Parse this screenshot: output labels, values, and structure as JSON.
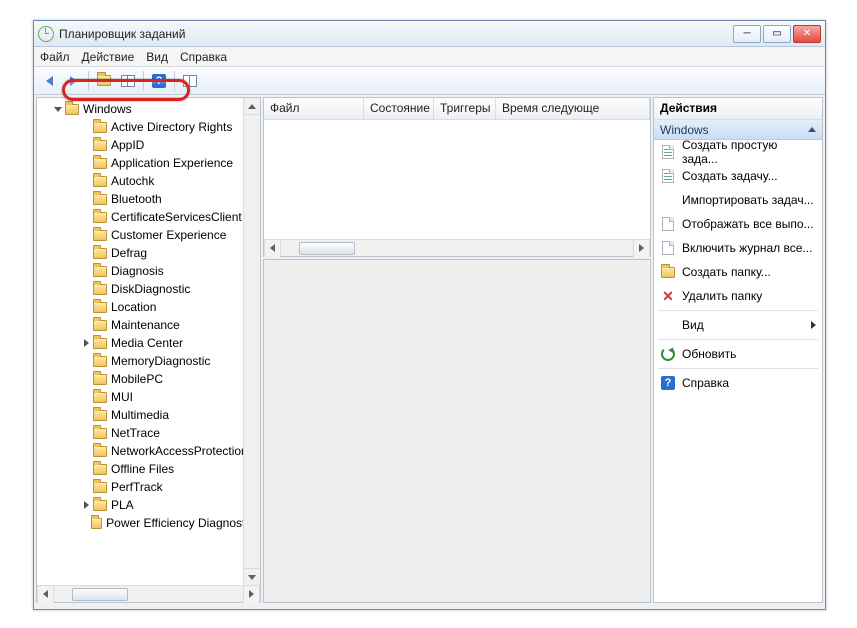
{
  "window": {
    "title": "Планировщик заданий"
  },
  "menu": {
    "file": "Файл",
    "action": "Действие",
    "view": "Вид",
    "help": "Справка"
  },
  "tree": {
    "root": "Windows",
    "children": [
      {
        "label": "Active Directory Rights",
        "expandable": false
      },
      {
        "label": "AppID",
        "expandable": false
      },
      {
        "label": "Application Experience",
        "expandable": false
      },
      {
        "label": "Autochk",
        "expandable": false
      },
      {
        "label": "Bluetooth",
        "expandable": false
      },
      {
        "label": "CertificateServicesClient",
        "expandable": false
      },
      {
        "label": "Customer Experience",
        "expandable": false
      },
      {
        "label": "Defrag",
        "expandable": false
      },
      {
        "label": "Diagnosis",
        "expandable": false
      },
      {
        "label": "DiskDiagnostic",
        "expandable": false
      },
      {
        "label": "Location",
        "expandable": false
      },
      {
        "label": "Maintenance",
        "expandable": false
      },
      {
        "label": "Media Center",
        "expandable": true
      },
      {
        "label": "MemoryDiagnostic",
        "expandable": false
      },
      {
        "label": "MobilePC",
        "expandable": false
      },
      {
        "label": "MUI",
        "expandable": false
      },
      {
        "label": "Multimedia",
        "expandable": false
      },
      {
        "label": "NetTrace",
        "expandable": false
      },
      {
        "label": "NetworkAccessProtection",
        "expandable": false
      },
      {
        "label": "Offline Files",
        "expandable": false
      },
      {
        "label": "PerfTrack",
        "expandable": false
      },
      {
        "label": "PLA",
        "expandable": true
      },
      {
        "label": "Power Efficiency Diagnostics",
        "expandable": false
      }
    ]
  },
  "listColumns": {
    "c0": "Файл",
    "c1": "Состояние",
    "c2": "Триггеры",
    "c3": "Время следующе"
  },
  "actions": {
    "paneTitle": "Действия",
    "context": "Windows",
    "items": {
      "createBasic": "Создать простую зада...",
      "createTask": "Создать задачу...",
      "import": "Импортировать задач...",
      "showRunning": "Отображать все выпо...",
      "enableHistory": "Включить журнал все...",
      "newFolder": "Создать папку...",
      "deleteFolder": "Удалить папку",
      "view": "Вид",
      "refresh": "Обновить",
      "help": "Справка"
    }
  }
}
